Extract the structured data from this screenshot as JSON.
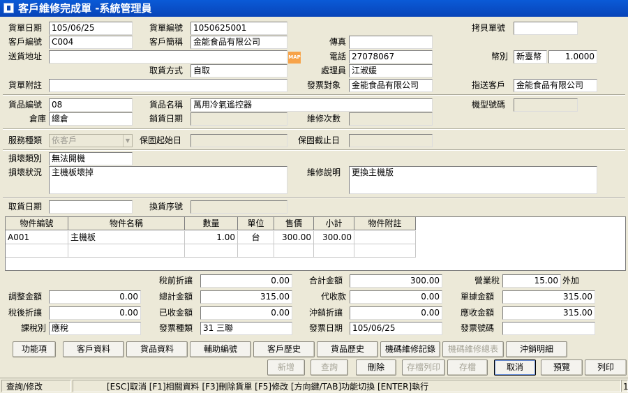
{
  "window": {
    "title": "客戶維修完成單 -系統管理員"
  },
  "form": {
    "order_date": {
      "label": "貨單日期",
      "value": "105/06/25"
    },
    "order_no": {
      "label": "貨單編號",
      "value": "1050625001"
    },
    "copy_no": {
      "label": "拷貝單號",
      "value": ""
    },
    "cust_id": {
      "label": "客戶編號",
      "value": "C004"
    },
    "cust_name": {
      "label": "客戶簡稱",
      "value": "金能食品有限公司"
    },
    "fax": {
      "label": "傳真",
      "value": ""
    },
    "address": {
      "label": "送貨地址",
      "value": ""
    },
    "map_label": "MAP",
    "phone": {
      "label": "電話",
      "value": "27078067"
    },
    "currency": {
      "label": "幣別",
      "value": "新臺幣",
      "rate": "1.0000"
    },
    "pickup": {
      "label": "取貨方式",
      "value": "自取"
    },
    "handler": {
      "label": "處理員",
      "value": "江淑媛"
    },
    "remark": {
      "label": "貨單附註",
      "value": ""
    },
    "invoice_to": {
      "label": "發票對象",
      "value": "金能食品有限公司"
    },
    "ship_cust": {
      "label": "指送客戶",
      "value": "金能食品有限公司"
    },
    "item_no": {
      "label": "貨品編號",
      "value": "08"
    },
    "item_name": {
      "label": "貨品名稱",
      "value": "萬用冷氣遙控器"
    },
    "model_no": {
      "label": "機型號碼",
      "value": ""
    },
    "warehouse": {
      "label": "倉庫",
      "value": "總倉"
    },
    "sale_date": {
      "label": "銷貨日期",
      "value": ""
    },
    "repair_count": {
      "label": "維修次數",
      "value": ""
    },
    "service_type": {
      "label": "服務種類",
      "value": "依客戶"
    },
    "warranty_start": {
      "label": "保固起始日",
      "value": ""
    },
    "warranty_end": {
      "label": "保固截止日",
      "value": ""
    },
    "damage_type": {
      "label": "損壞類別",
      "value": "無法開機"
    },
    "damage_status": {
      "label": "損壞狀況",
      "value": "主機板壞掉"
    },
    "repair_desc": {
      "label": "維修說明",
      "value": "更換主機版"
    },
    "pickup_date": {
      "label": "取貨日期",
      "value": ""
    },
    "swap_serial": {
      "label": "換貨序號",
      "value": ""
    }
  },
  "grid": {
    "headers": [
      "物件編號",
      "物件名稱",
      "數量",
      "單位",
      "售價",
      "小計",
      "物件附註"
    ],
    "rows": [
      [
        "A001",
        "主機板",
        "1.00",
        "台",
        "300.00",
        "300.00",
        ""
      ]
    ]
  },
  "totals": {
    "pre_tax_discount": {
      "label": "稅前折讓",
      "value": "0.00"
    },
    "total_amount": {
      "label": "合計金額",
      "value": "300.00"
    },
    "business_tax": {
      "label": "營業稅",
      "value": "15.00",
      "suffix": "外加"
    },
    "adjust_amount": {
      "label": "調整金額",
      "value": "0.00"
    },
    "grand_total": {
      "label": "總計金額",
      "value": "315.00"
    },
    "collected": {
      "label": "代收款",
      "value": "0.00"
    },
    "doc_amount": {
      "label": "單據金額",
      "value": "315.00"
    },
    "after_tax_discount": {
      "label": "稅後折讓",
      "value": "0.00"
    },
    "received": {
      "label": "已收金額",
      "value": "0.00"
    },
    "offset_discount": {
      "label": "沖銷折讓",
      "value": "0.00"
    },
    "receivable": {
      "label": "應收金額",
      "value": "315.00"
    },
    "tax_type": {
      "label": "課稅別",
      "value": "應稅"
    },
    "invoice_type": {
      "label": "發票種類",
      "value": "31 三聯"
    },
    "invoice_date": {
      "label": "發票日期",
      "value": "105/06/25"
    },
    "invoice_no": {
      "label": "發票號碼",
      "value": ""
    }
  },
  "toolbar1": [
    "功能項",
    "客戶資料",
    "貨品資料",
    "輔助編號",
    "客戶歷史",
    "貨品歷史",
    "機碼維修記錄",
    "機碼維修總表",
    "沖銷明細"
  ],
  "toolbar2": [
    "新增",
    "查詢",
    "刪除",
    "存檔列印",
    "存檔",
    "取消",
    "預覽",
    "列印"
  ],
  "status": {
    "mode": "查詢/修改",
    "hint": "[ESC]取消 [F1]相關資料 [F3]刪除貨單 [F5]修改 [方向鍵/TAB]功能切換 [ENTER]執行",
    "page": "1"
  }
}
